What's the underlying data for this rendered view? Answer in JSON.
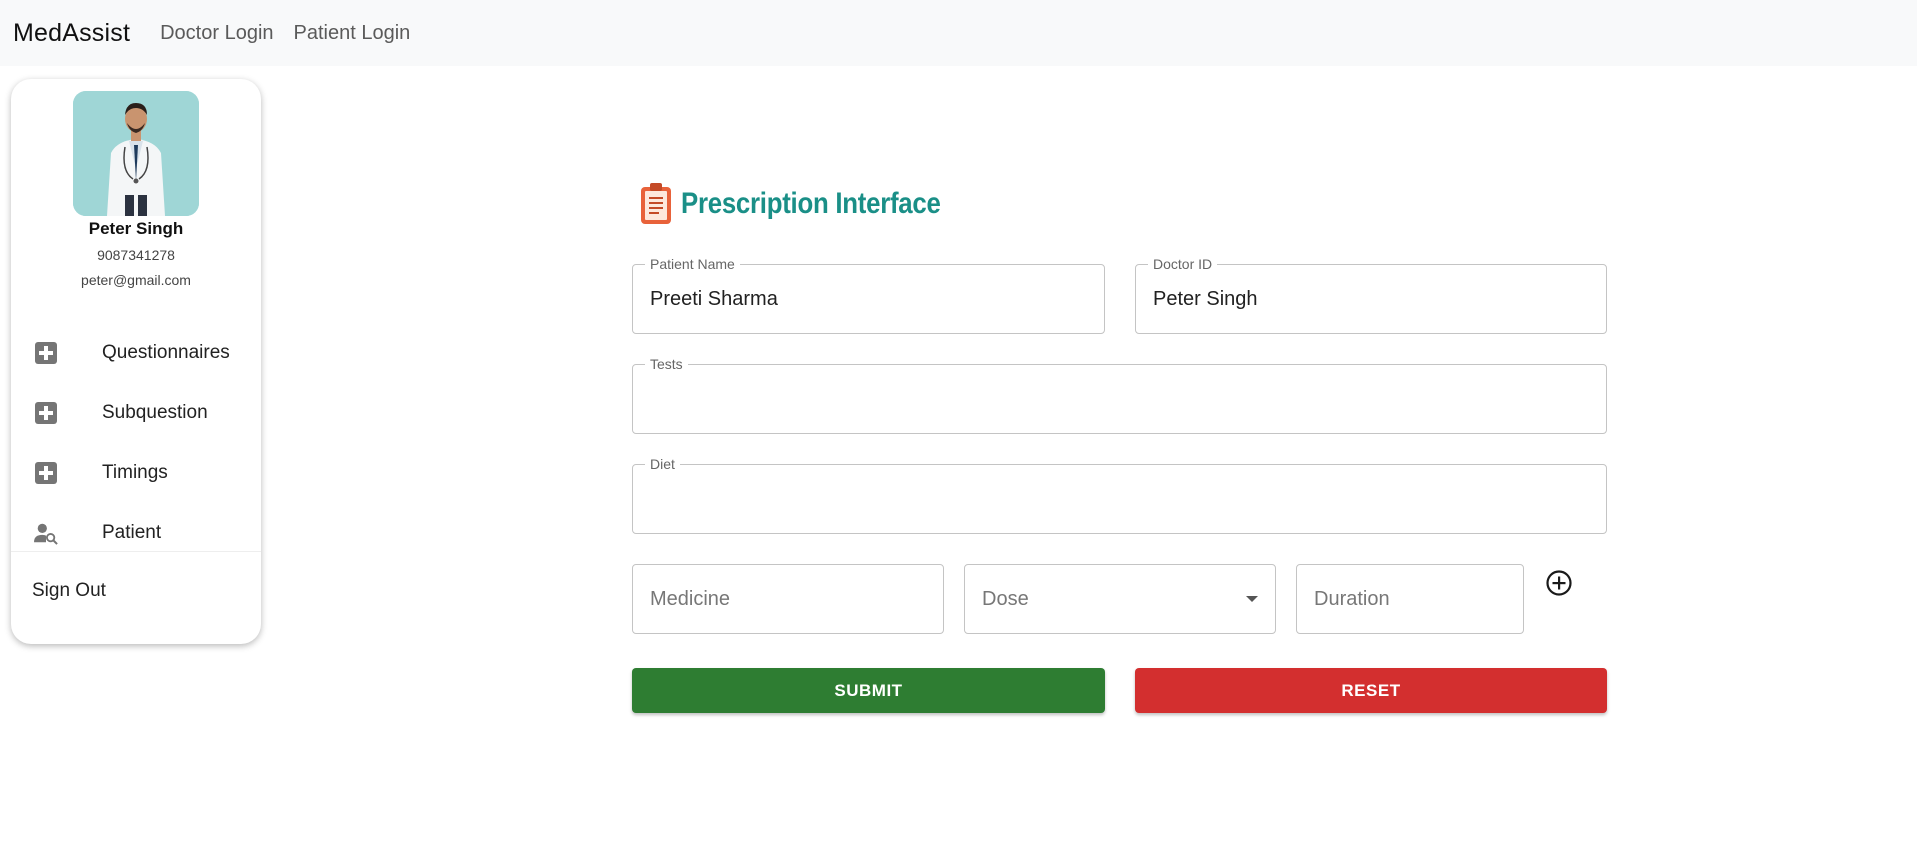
{
  "navbar": {
    "brand": "MedAssist",
    "links": [
      "Doctor Login",
      "Patient Login"
    ]
  },
  "profile": {
    "name": "Peter Singh",
    "phone": "9087341278",
    "email": "peter@gmail.com"
  },
  "sidebar": {
    "items": [
      {
        "label": "Questionnaires",
        "icon": "plus-box-icon"
      },
      {
        "label": "Subquestion",
        "icon": "plus-box-icon"
      },
      {
        "label": "Timings",
        "icon": "plus-box-icon"
      },
      {
        "label": "Patient",
        "icon": "person-search-icon"
      }
    ],
    "signout": "Sign Out"
  },
  "form": {
    "title": "Prescription Interface",
    "patient_name": {
      "label": "Patient Name",
      "value": "Preeti Sharma"
    },
    "doctor_id": {
      "label": "Doctor ID",
      "value": "Peter Singh"
    },
    "tests": {
      "label": "Tests",
      "value": ""
    },
    "diet": {
      "label": "Diet",
      "value": ""
    },
    "medicine": {
      "placeholder": "Medicine"
    },
    "dose": {
      "placeholder": "Dose"
    },
    "duration": {
      "placeholder": "Duration"
    },
    "submit_label": "SUBMIT",
    "reset_label": "RESET"
  },
  "colors": {
    "title": "#1a8f87",
    "submit": "#2e7d32",
    "reset": "#d32f2f",
    "navbar_bg": "#f8f9fa"
  }
}
